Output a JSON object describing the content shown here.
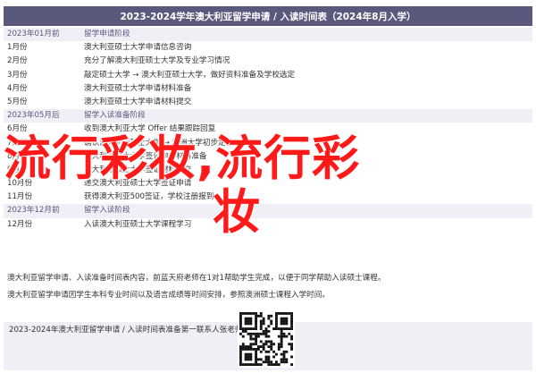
{
  "header": {
    "title": "2023-2024学年澳大利亚留学申请 / 入读时间表（2024年8月入学）"
  },
  "rows": [
    {
      "date": "2023年01月前",
      "desc": "留学申请阶段",
      "section": true
    },
    {
      "date": "1月份",
      "desc": "澳大利亚硕士大学申请信息咨询",
      "section": false
    },
    {
      "date": "2月份",
      "desc": "充分了解澳大利亚硕士大学及专业学习情况",
      "section": false
    },
    {
      "date": "3月份",
      "desc": "敲定硕士大学 → 澳大利亚硕士大学，做好资料准备及学校选定",
      "section": false
    },
    {
      "date": "4月份",
      "desc": "澳大利亚硕士大学申请材料准备",
      "section": false
    },
    {
      "date": "5月份",
      "desc": "澳大利亚硕士大学申请材料提交",
      "section": false
    },
    {
      "date": "2023年05月后",
      "desc": "留学入读准备阶段",
      "section": true
    },
    {
      "date": "6月份",
      "desc": "收到澳大利亚大学 Offer 结果跟踪回复",
      "section": false
    },
    {
      "date": "7月份",
      "desc": "确认澳大利亚硕士大学 → 澳洲大学初步定校",
      "section": false
    },
    {
      "date": "8月份",
      "desc": "澳大利亚硕士大学签证申请材料准备",
      "section": false
    },
    {
      "date": "9月份",
      "desc": "澳大利亚硕士大学签证材料提交",
      "section": false
    },
    {
      "date": "10月份",
      "desc": "递交澳大利亚硕士大学签证申请",
      "section": false
    },
    {
      "date": "11月份",
      "desc": "获得澳大利亚500签证，学校注册报到",
      "section": false
    },
    {
      "date": "2023年12月前",
      "desc": "留学入读阶段",
      "section": true
    },
    {
      "date": "12月份",
      "desc": "入读澳大利亚硕士大学课程学习",
      "section": false
    }
  ],
  "notes": [
    "澳大利亚留学申请、入读准备时间表内容，前蓝天府老师在1对1帮助学生完成，以便于同学帮助入读硕士课程。",
    "澳大利亚留学申请因学生本科专业时间以及语言成绩等时间安排，参照澳洲硕士课程入学时间。"
  ],
  "footer": {
    "text": "2023-2024年澳大利亚留学申请 / 入读时间表准备第一联系人张老师："
  },
  "overlay": {
    "line1": "流行彩妆,流行彩",
    "line2": "妆"
  },
  "colors": {
    "header_bg": "#5b587e",
    "overlay_text": "#ff1a1a",
    "section_bg": "#f0eff6"
  }
}
